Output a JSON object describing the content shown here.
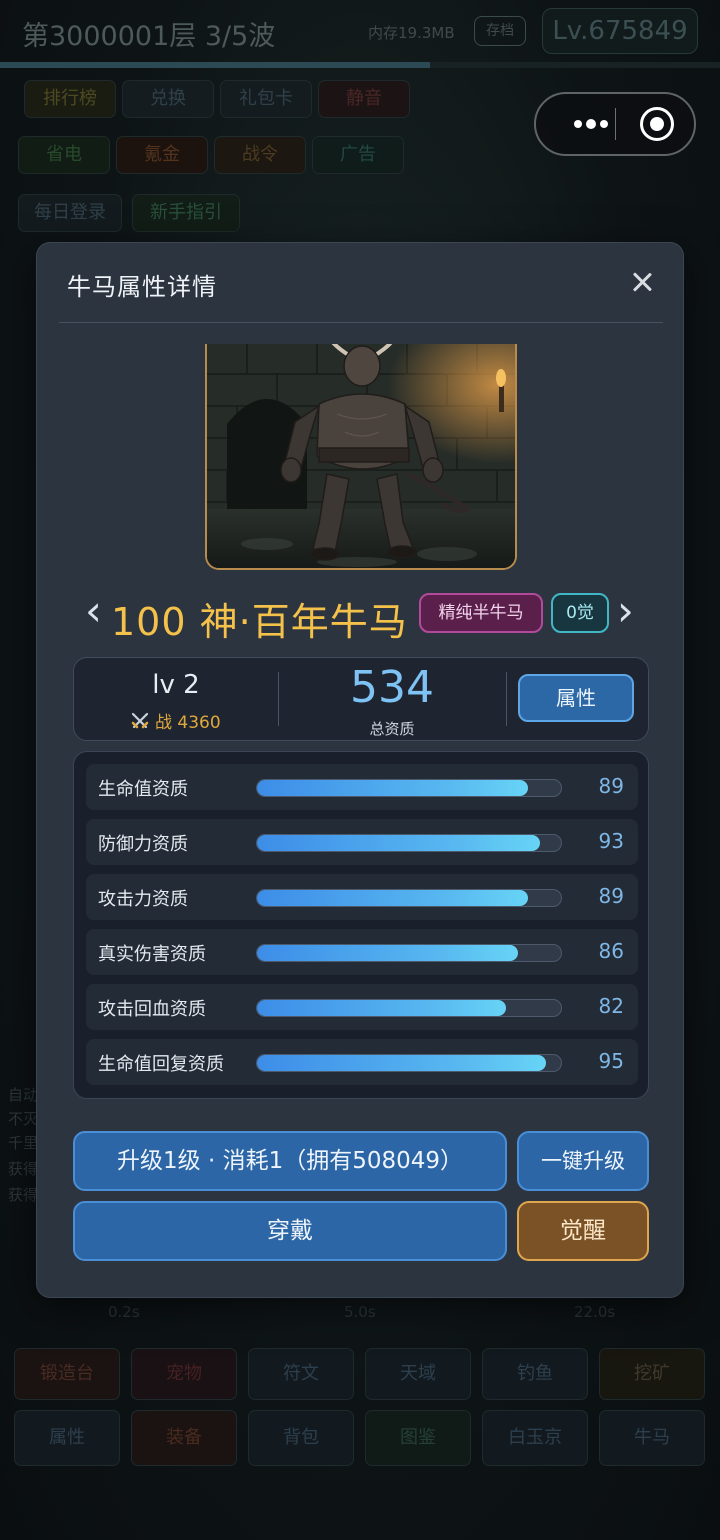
{
  "background": {
    "floor_title": "第3000001层  3/5波",
    "memory": "内存19.3MB",
    "save_label": "存档",
    "level": "Lv.675849",
    "row1": [
      "排行榜",
      "兑换",
      "礼包卡",
      "静音"
    ],
    "row2": [
      "省电",
      "氪金",
      "战令",
      "广告"
    ],
    "row3": [
      "每日登录",
      "新手指引"
    ],
    "timers": [
      "0.2s",
      "5.0s",
      "22.0s"
    ],
    "side_text": [
      "自动",
      "不灭",
      "千里",
      "获得",
      "获得"
    ],
    "bottom_row1": [
      "锻造台",
      "宠物",
      "符文",
      "天域",
      "钓鱼",
      "挖矿"
    ],
    "bottom_row2": [
      "属性",
      "装备",
      "背包",
      "图鉴",
      "白玉京",
      "牛马"
    ]
  },
  "capsule": {
    "more_icon": "more-dots-icon",
    "close_icon": "target-icon"
  },
  "modal": {
    "title": "牛马属性详情",
    "close_icon": "close-icon",
    "prev_arrow": "‹",
    "next_arrow": "›",
    "hero_name": "100  神·百年牛马",
    "rarity_badge": "精纯半牛马",
    "awaken_badge": "0觉",
    "level": "lv 2",
    "power_label": "战 4360",
    "total_value": "534",
    "total_label": "总资质",
    "attr_button": "属性",
    "stats": [
      {
        "label": "生命值资质",
        "value": "89",
        "percent": 89
      },
      {
        "label": "防御力资质",
        "value": "93",
        "percent": 93
      },
      {
        "label": "攻击力资质",
        "value": "89",
        "percent": 89
      },
      {
        "label": "真实伤害资质",
        "value": "86",
        "percent": 86
      },
      {
        "label": "攻击回血资质",
        "value": "82",
        "percent": 82
      },
      {
        "label": "生命值回复资质",
        "value": "95",
        "percent": 95
      }
    ],
    "upgrade_button": "升级1级 · 消耗1（拥有508049）",
    "onekey_button": "一键升级",
    "wear_button": "穿戴",
    "awaken_button": "觉醒"
  },
  "colors": {
    "accent_gold": "#f4c24a",
    "accent_blue": "#7fc3f5",
    "button_blue": "#2c66a6",
    "button_gold": "#7a5226",
    "modal_bg": "#2c3440"
  }
}
